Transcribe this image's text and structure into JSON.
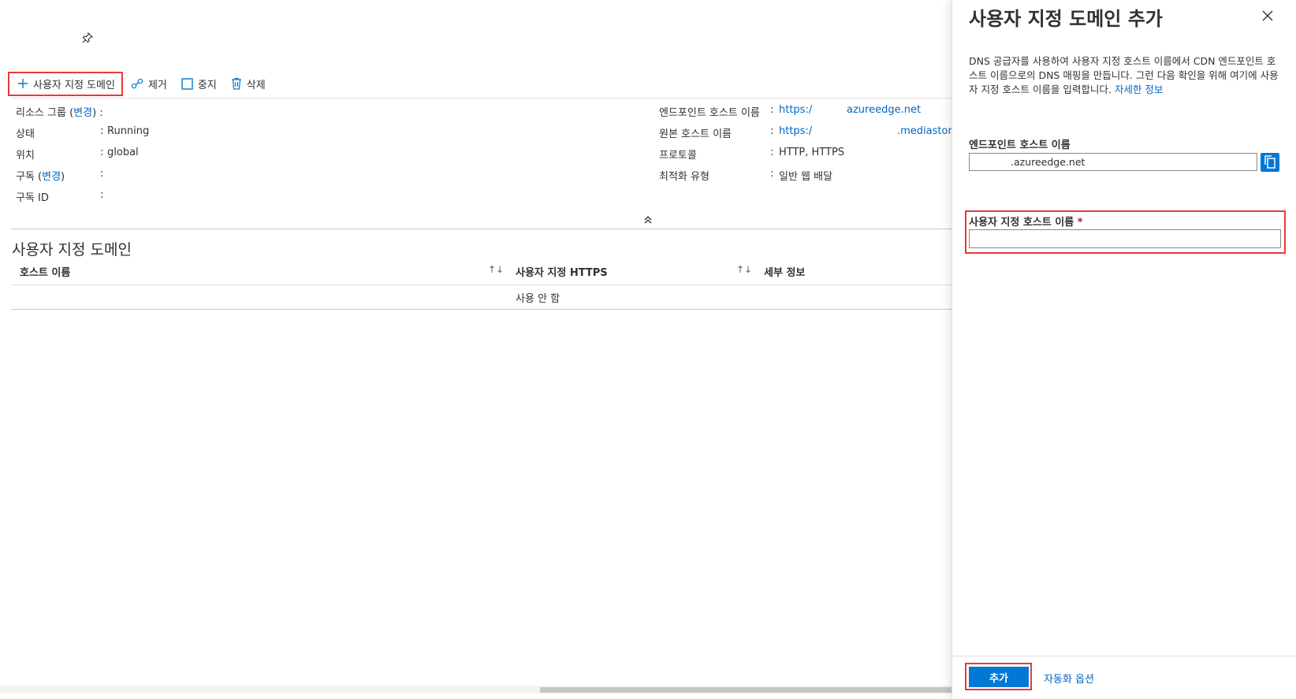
{
  "toolbar": {
    "add_custom_domain": "사용자 지정 도메인",
    "remove": "제거",
    "stop": "중지",
    "delete": "삭제"
  },
  "essentials_left": [
    {
      "label": "리소스 그룹 (",
      "link": "변경",
      "label_suffix": ")",
      "colon": ":",
      "value": ""
    },
    {
      "label": "상태",
      "colon": ":",
      "value": "Running"
    },
    {
      "label": "위치",
      "colon": ":",
      "value": "global"
    },
    {
      "label": "구독 (",
      "link": "변경",
      "label_suffix": ")",
      "colon": ":",
      "value": ""
    },
    {
      "label": "구독 ID",
      "colon": ":",
      "value": ""
    }
  ],
  "essentials_right": [
    {
      "label": "엔드포인트 호스트 이름",
      "colon": ":",
      "value_link": "https:/",
      "value_link2": "azureedge.net"
    },
    {
      "label": "원본 호스트 이름",
      "colon": ":",
      "value_link": "https:/",
      "value_link2": ".mediastor"
    },
    {
      "label": "프로토콜",
      "colon": ":",
      "value": "HTTP, HTTPS"
    },
    {
      "label": "최적화 유형",
      "colon": ":",
      "value": "일반 웹 배달"
    }
  ],
  "section": {
    "title": "사용자 지정 도메인",
    "columns": [
      "호스트 이름",
      "사용자 지정 HTTPS",
      "세부 정보"
    ],
    "rows": [
      {
        "hostname": "",
        "custom_https": "사용 안 함",
        "details": ""
      }
    ]
  },
  "panel": {
    "title": "사용자 지정 도메인 추가",
    "description": "DNS 공급자를 사용하여 사용자 지정 호스트 이름에서 CDN 엔드포인트 호스트 이름으로의 DNS 매핑을 만듭니다. 그런 다음 확인을 위해 여기에 사용자 지정 호스트 이름을 입력합니다.",
    "learn_more": "자세한 정보",
    "endpoint_label": "엔드포인트 호스트 이름",
    "endpoint_value": ".azureedge.net",
    "custom_host_label": "사용자 지정 호스트 이름",
    "required_mark": "*",
    "custom_host_value": "",
    "add_button": "추가",
    "automation_options": "자동화 옵션"
  }
}
